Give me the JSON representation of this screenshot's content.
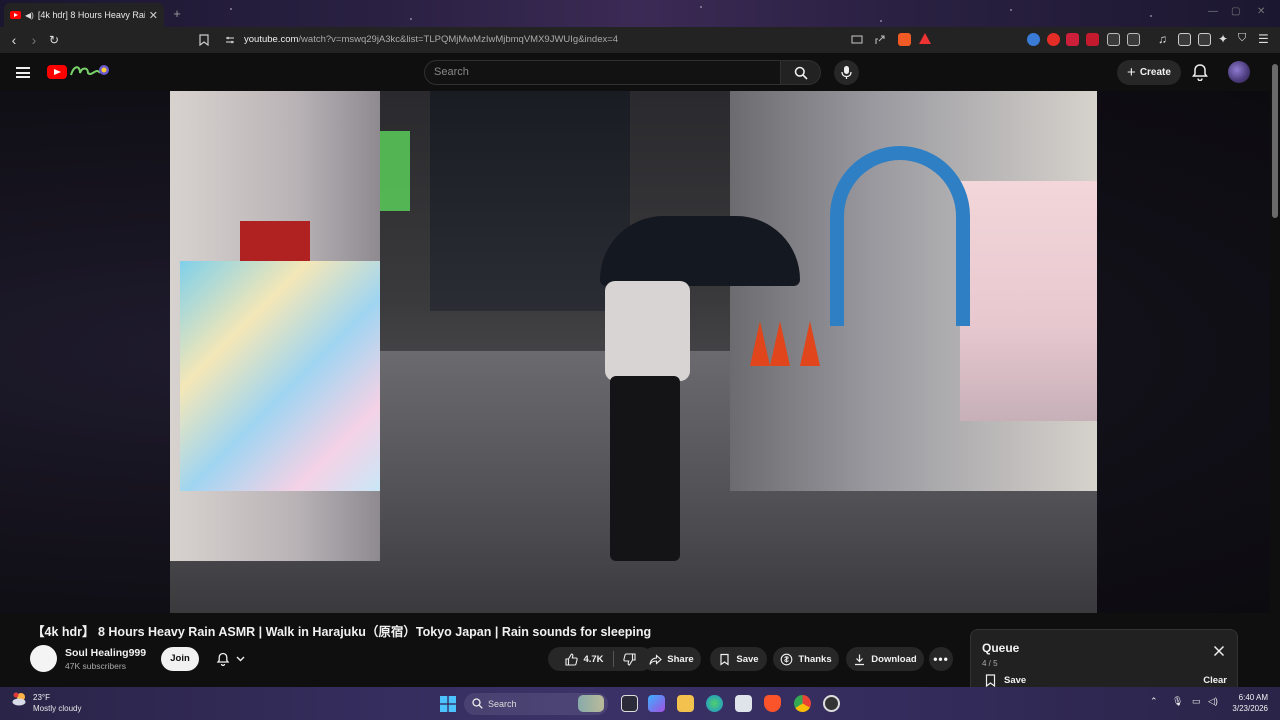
{
  "browser": {
    "tab_title": "[4k hdr] 8 Hours Heavy Rain",
    "tab_close": "✕",
    "new_tab": "+",
    "url_host": "youtube.com",
    "url_path": "/watch?v=mswq29jA3kc&list=TLPQMjMwMzIwMjbmqVMX9JWUIg&index=4"
  },
  "masthead": {
    "search_placeholder": "Search",
    "create_label": "Create"
  },
  "video": {
    "title": "【4k hdr】 8 Hours Heavy Rain ASMR | Walk in Harajuku（原宿）Tokyo Japan | Rain sounds for sleeping"
  },
  "channel": {
    "name": "Soul Healing999",
    "subscribers": "47K subscribers",
    "join_label": "Join"
  },
  "actions": {
    "like_count": "4.7K",
    "share_label": "Share",
    "save_label": "Save",
    "thanks_label": "Thanks",
    "download_label": "Download"
  },
  "queue": {
    "title": "Queue",
    "position": "4 / 5",
    "save_label": "Save",
    "clear_label": "Clear"
  },
  "taskbar": {
    "temperature": "23°F",
    "weather": "Mostly cloudy",
    "search_label": "Search",
    "time": "6:40 AM",
    "date": "3/23/2026"
  },
  "colors": {
    "youtube_red": "#ff0000",
    "background": "#0f0f0f",
    "pill": "#272727"
  }
}
